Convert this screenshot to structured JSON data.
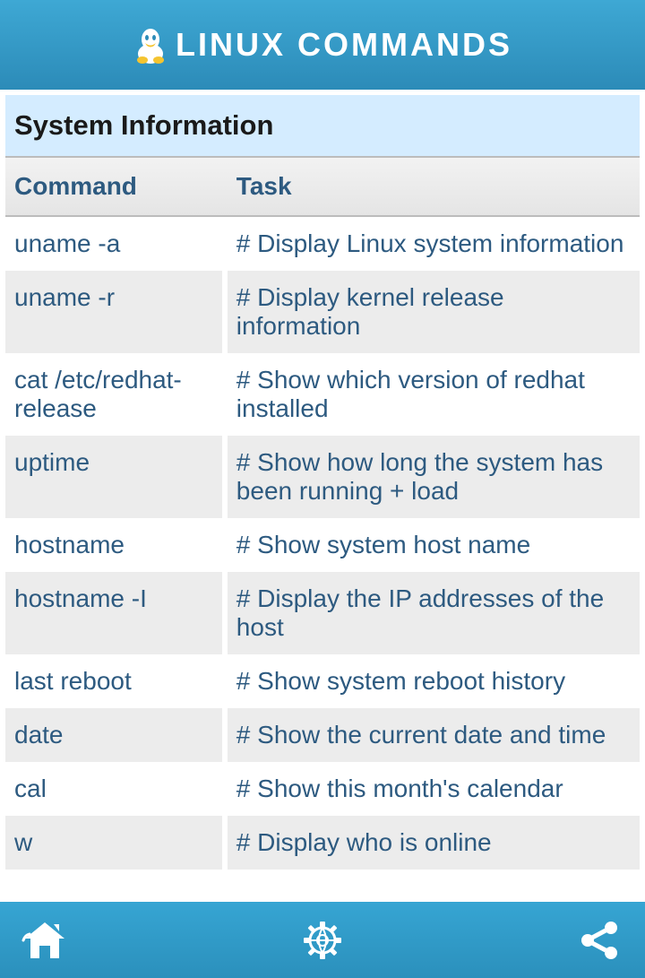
{
  "header": {
    "title": "LINUX COMMANDS"
  },
  "section": {
    "title": "System Information"
  },
  "table": {
    "headers": {
      "command": "Command",
      "task": "Task"
    },
    "rows": [
      {
        "command": "uname -a",
        "task": "# Display Linux system information"
      },
      {
        "command": "uname -r",
        "task": "# Display kernel release information"
      },
      {
        "command": "cat /etc/redhat-release",
        "task": "# Show which version of redhat installed"
      },
      {
        "command": "uptime",
        "task": "# Show how long the system has been running + load"
      },
      {
        "command": "hostname",
        "task": "# Show system host name"
      },
      {
        "command": "hostname -I",
        "task": "# Display the IP addresses of the host"
      },
      {
        "command": "last reboot",
        "task": "# Show system reboot history"
      },
      {
        "command": "date",
        "task": "# Show the current date and time"
      },
      {
        "command": "cal",
        "task": "# Show this month's calendar"
      },
      {
        "command": "w",
        "task": "# Display who is online"
      }
    ]
  }
}
